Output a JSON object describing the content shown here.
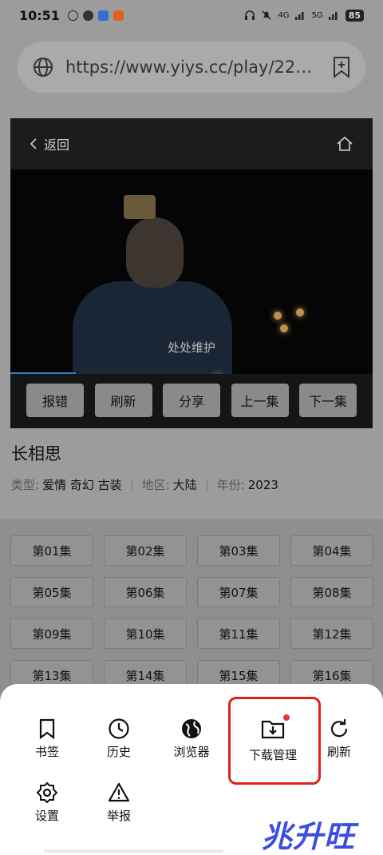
{
  "status_bar": {
    "time": "10:51",
    "network_label": "4G",
    "network_label2": "5G",
    "battery": "85"
  },
  "browser": {
    "url": "https://www.yiys.cc/play/22…",
    "icons": [
      "globe-icon",
      "bookmark-add-icon"
    ]
  },
  "player": {
    "back_label": "返回",
    "subtitle": "处处维护",
    "progress_fraction": 0.18,
    "buttons": [
      "报错",
      "刷新",
      "分享",
      "上一集",
      "下一集"
    ]
  },
  "show": {
    "title": "长相思",
    "type_label": "类型:",
    "types": "爱情  奇幻  古装",
    "region_label": "地区:",
    "region": "大陆",
    "year_label": "年份:",
    "year": "2023"
  },
  "episodes": [
    "第01集",
    "第02集",
    "第03集",
    "第04集",
    "第05集",
    "第06集",
    "第07集",
    "第08集",
    "第09集",
    "第10集",
    "第11集",
    "第12集",
    "第13集",
    "第14集",
    "第15集",
    "第16集"
  ],
  "menu": {
    "items": [
      {
        "label": "书签",
        "icon": "bookmark-icon"
      },
      {
        "label": "历史",
        "icon": "clock-icon"
      },
      {
        "label": "浏览器",
        "icon": "globe-icon"
      },
      {
        "label": "下载管理",
        "icon": "download-folder-icon"
      },
      {
        "label": "刷新",
        "icon": "refresh-icon"
      },
      {
        "label": "设置",
        "icon": "gear-icon"
      },
      {
        "label": "举报",
        "icon": "warning-icon"
      }
    ],
    "highlight_color": "#e02020"
  },
  "watermark": "兆升旺"
}
